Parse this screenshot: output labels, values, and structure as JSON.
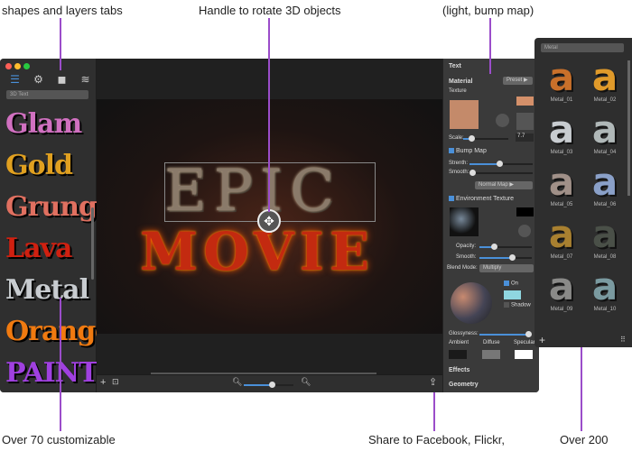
{
  "annotations": {
    "top_left": "shapes and layers tabs",
    "top_center": "Handle to rotate 3D objects",
    "top_right": "(light, bump map)",
    "bottom_left": "Over 70 customizable",
    "bottom_center": "Share to Facebook, Flickr,",
    "bottom_right": "Over 200",
    "accent": "#9b4dca"
  },
  "sidebar": {
    "tabs": [
      "text-list-icon",
      "gear-icon",
      "shapes-icon",
      "layers-icon"
    ],
    "category": "3D Text",
    "styles": [
      {
        "label": "Glam",
        "color": "#d070c0"
      },
      {
        "label": "Gold",
        "color": "#e0a020"
      },
      {
        "label": "Grunge",
        "color": "#e07060"
      },
      {
        "label": "Lava",
        "color": "#d02010"
      },
      {
        "label": "Metal",
        "color": "#c8ccd0"
      },
      {
        "label": "Orange",
        "color": "#f07a10"
      },
      {
        "label": "PAINT",
        "color": "#a040e0"
      }
    ]
  },
  "canvas": {
    "line1": "EPIC",
    "line2": "MOVIE"
  },
  "panel": {
    "title": "Text",
    "material": "Material",
    "preset": "Preset",
    "texture": "Texture",
    "scale_label": "Scale:",
    "scale_value": "7.7",
    "bump_map": "Bump Map",
    "strength": "Strenth:",
    "smooth": "Smooth:",
    "normal_map": "Normal Map",
    "env_texture": "Environment Texture",
    "opacity": "Opacity:",
    "smooth2": "Smooth:",
    "blend_label": "Blend Mode:",
    "blend_value": "Multiply",
    "on": "On",
    "shadow": "Shadow",
    "glossyness": "Glossyness:",
    "ambient": "Ambient",
    "diffuse": "Diffuse",
    "specular": "Specular",
    "effects": "Effects",
    "geometry": "Geometry",
    "texture_color": "#d4906a",
    "light_color": "#8fd6e0"
  },
  "library": {
    "category": "Metal",
    "items": [
      {
        "label": "Metal_01",
        "color": "#c8702a"
      },
      {
        "label": "Metal_02",
        "color": "#e09a2a"
      },
      {
        "label": "Metal_03",
        "color": "#c8ccd0"
      },
      {
        "label": "Metal_04",
        "color": "#b0b8b8"
      },
      {
        "label": "Metal_05",
        "color": "#a09088"
      },
      {
        "label": "Metal_06",
        "color": "#8aa0c8"
      },
      {
        "label": "Metal_07",
        "color": "#a88030"
      },
      {
        "label": "Metal_08",
        "color": "#4a5048"
      },
      {
        "label": "Metal_09",
        "color": "#8a8a88"
      },
      {
        "label": "Metal_10",
        "color": "#7a9aa0"
      }
    ]
  }
}
